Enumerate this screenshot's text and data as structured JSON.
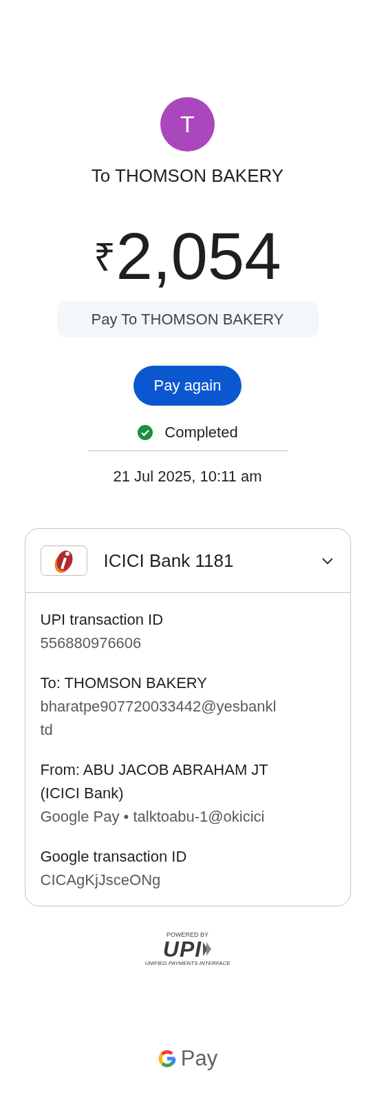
{
  "avatar": {
    "initial": "T",
    "color": "#ab47bc"
  },
  "recipient_title": "To THOMSON BAKERY",
  "amount": {
    "currency": "₹",
    "value": "2,054"
  },
  "note": "Pay To THOMSON BAKERY",
  "pay_again_button": "Pay again",
  "status": {
    "label": "Completed",
    "completed": true
  },
  "datetime": "21 Jul 2025, 10:11 am",
  "account_card": {
    "bank": "ICICI Bank 1181",
    "expanded": true,
    "details": [
      {
        "label": "UPI transaction ID",
        "lines": [
          "556880976606"
        ]
      },
      {
        "label": "To: THOMSON BAKERY",
        "lines": [
          "bharatpe907720033442@yesbankl",
          "td"
        ]
      },
      {
        "label": "From: ABU JACOB ABRAHAM JT",
        "label_2": "(ICICI Bank)",
        "lines": [
          "Google Pay • talktoabu-1@okicici"
        ]
      },
      {
        "label": "Google transaction ID",
        "lines": [
          "CICAgKjJsceONg"
        ]
      }
    ]
  },
  "upi_badge": {
    "powered_by": "POWERED BY",
    "logo": "UPI",
    "tagline": "UNIFIED PAYMENTS INTERFACE"
  },
  "footer_brand": "Pay"
}
